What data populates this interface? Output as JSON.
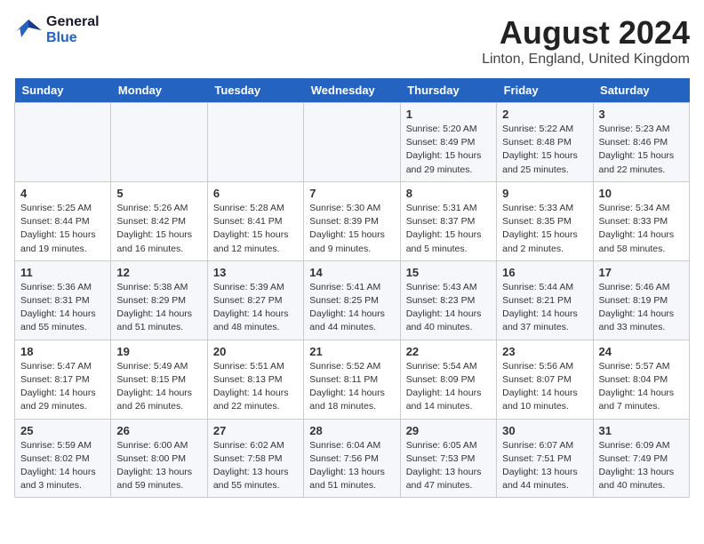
{
  "logo": {
    "line1": "General",
    "line2": "Blue"
  },
  "title": "August 2024",
  "subtitle": "Linton, England, United Kingdom",
  "days_of_week": [
    "Sunday",
    "Monday",
    "Tuesday",
    "Wednesday",
    "Thursday",
    "Friday",
    "Saturday"
  ],
  "weeks": [
    [
      {
        "day": "",
        "content": ""
      },
      {
        "day": "",
        "content": ""
      },
      {
        "day": "",
        "content": ""
      },
      {
        "day": "",
        "content": ""
      },
      {
        "day": "1",
        "content": "Sunrise: 5:20 AM\nSunset: 8:49 PM\nDaylight: 15 hours\nand 29 minutes."
      },
      {
        "day": "2",
        "content": "Sunrise: 5:22 AM\nSunset: 8:48 PM\nDaylight: 15 hours\nand 25 minutes."
      },
      {
        "day": "3",
        "content": "Sunrise: 5:23 AM\nSunset: 8:46 PM\nDaylight: 15 hours\nand 22 minutes."
      }
    ],
    [
      {
        "day": "4",
        "content": "Sunrise: 5:25 AM\nSunset: 8:44 PM\nDaylight: 15 hours\nand 19 minutes."
      },
      {
        "day": "5",
        "content": "Sunrise: 5:26 AM\nSunset: 8:42 PM\nDaylight: 15 hours\nand 16 minutes."
      },
      {
        "day": "6",
        "content": "Sunrise: 5:28 AM\nSunset: 8:41 PM\nDaylight: 15 hours\nand 12 minutes."
      },
      {
        "day": "7",
        "content": "Sunrise: 5:30 AM\nSunset: 8:39 PM\nDaylight: 15 hours\nand 9 minutes."
      },
      {
        "day": "8",
        "content": "Sunrise: 5:31 AM\nSunset: 8:37 PM\nDaylight: 15 hours\nand 5 minutes."
      },
      {
        "day": "9",
        "content": "Sunrise: 5:33 AM\nSunset: 8:35 PM\nDaylight: 15 hours\nand 2 minutes."
      },
      {
        "day": "10",
        "content": "Sunrise: 5:34 AM\nSunset: 8:33 PM\nDaylight: 14 hours\nand 58 minutes."
      }
    ],
    [
      {
        "day": "11",
        "content": "Sunrise: 5:36 AM\nSunset: 8:31 PM\nDaylight: 14 hours\nand 55 minutes."
      },
      {
        "day": "12",
        "content": "Sunrise: 5:38 AM\nSunset: 8:29 PM\nDaylight: 14 hours\nand 51 minutes."
      },
      {
        "day": "13",
        "content": "Sunrise: 5:39 AM\nSunset: 8:27 PM\nDaylight: 14 hours\nand 48 minutes."
      },
      {
        "day": "14",
        "content": "Sunrise: 5:41 AM\nSunset: 8:25 PM\nDaylight: 14 hours\nand 44 minutes."
      },
      {
        "day": "15",
        "content": "Sunrise: 5:43 AM\nSunset: 8:23 PM\nDaylight: 14 hours\nand 40 minutes."
      },
      {
        "day": "16",
        "content": "Sunrise: 5:44 AM\nSunset: 8:21 PM\nDaylight: 14 hours\nand 37 minutes."
      },
      {
        "day": "17",
        "content": "Sunrise: 5:46 AM\nSunset: 8:19 PM\nDaylight: 14 hours\nand 33 minutes."
      }
    ],
    [
      {
        "day": "18",
        "content": "Sunrise: 5:47 AM\nSunset: 8:17 PM\nDaylight: 14 hours\nand 29 minutes."
      },
      {
        "day": "19",
        "content": "Sunrise: 5:49 AM\nSunset: 8:15 PM\nDaylight: 14 hours\nand 26 minutes."
      },
      {
        "day": "20",
        "content": "Sunrise: 5:51 AM\nSunset: 8:13 PM\nDaylight: 14 hours\nand 22 minutes."
      },
      {
        "day": "21",
        "content": "Sunrise: 5:52 AM\nSunset: 8:11 PM\nDaylight: 14 hours\nand 18 minutes."
      },
      {
        "day": "22",
        "content": "Sunrise: 5:54 AM\nSunset: 8:09 PM\nDaylight: 14 hours\nand 14 minutes."
      },
      {
        "day": "23",
        "content": "Sunrise: 5:56 AM\nSunset: 8:07 PM\nDaylight: 14 hours\nand 10 minutes."
      },
      {
        "day": "24",
        "content": "Sunrise: 5:57 AM\nSunset: 8:04 PM\nDaylight: 14 hours\nand 7 minutes."
      }
    ],
    [
      {
        "day": "25",
        "content": "Sunrise: 5:59 AM\nSunset: 8:02 PM\nDaylight: 14 hours\nand 3 minutes."
      },
      {
        "day": "26",
        "content": "Sunrise: 6:00 AM\nSunset: 8:00 PM\nDaylight: 13 hours\nand 59 minutes."
      },
      {
        "day": "27",
        "content": "Sunrise: 6:02 AM\nSunset: 7:58 PM\nDaylight: 13 hours\nand 55 minutes."
      },
      {
        "day": "28",
        "content": "Sunrise: 6:04 AM\nSunset: 7:56 PM\nDaylight: 13 hours\nand 51 minutes."
      },
      {
        "day": "29",
        "content": "Sunrise: 6:05 AM\nSunset: 7:53 PM\nDaylight: 13 hours\nand 47 minutes."
      },
      {
        "day": "30",
        "content": "Sunrise: 6:07 AM\nSunset: 7:51 PM\nDaylight: 13 hours\nand 44 minutes."
      },
      {
        "day": "31",
        "content": "Sunrise: 6:09 AM\nSunset: 7:49 PM\nDaylight: 13 hours\nand 40 minutes."
      }
    ]
  ]
}
